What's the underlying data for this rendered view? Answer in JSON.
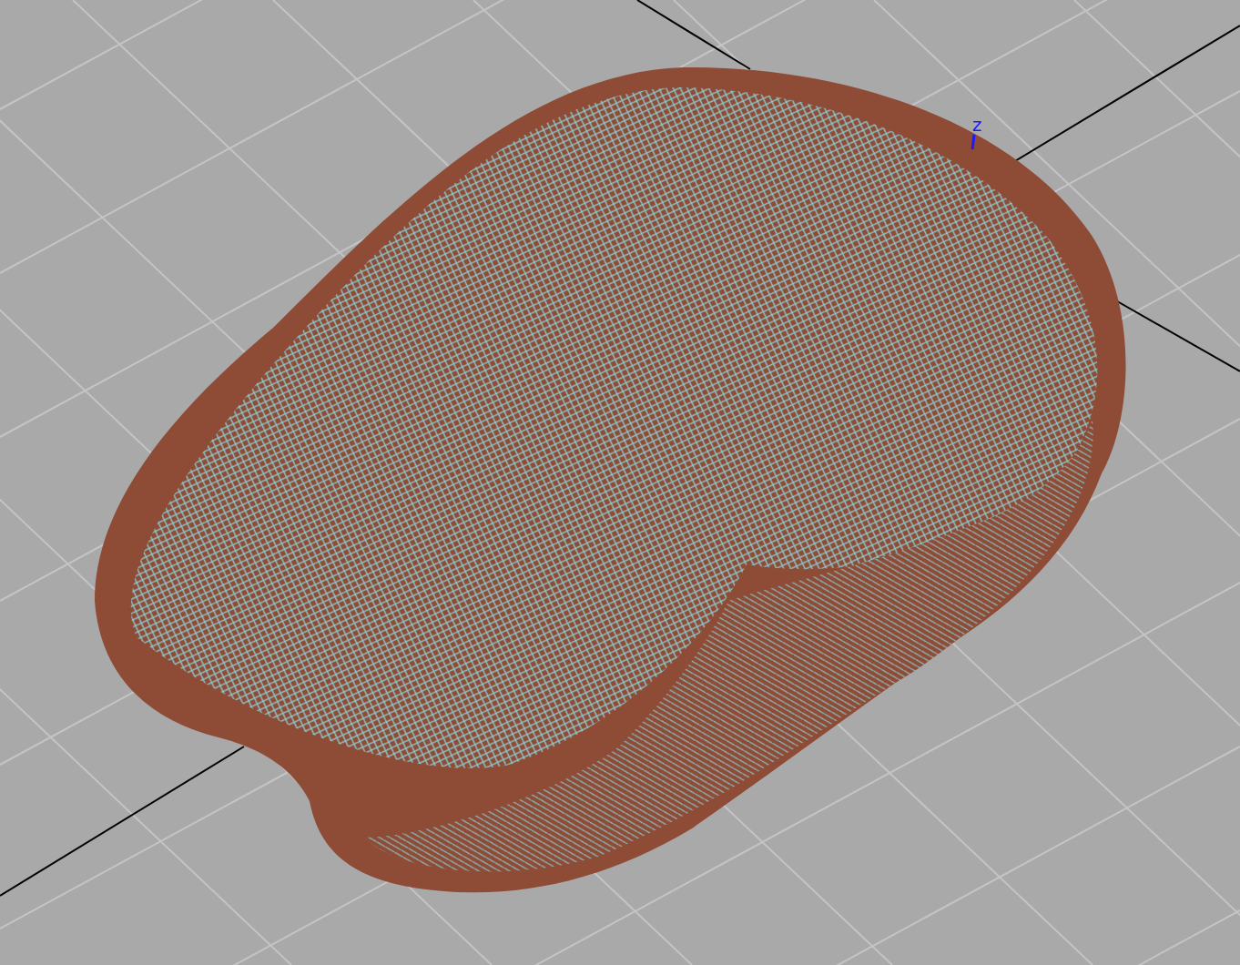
{
  "viewport": {
    "axis_label": "z"
  }
}
